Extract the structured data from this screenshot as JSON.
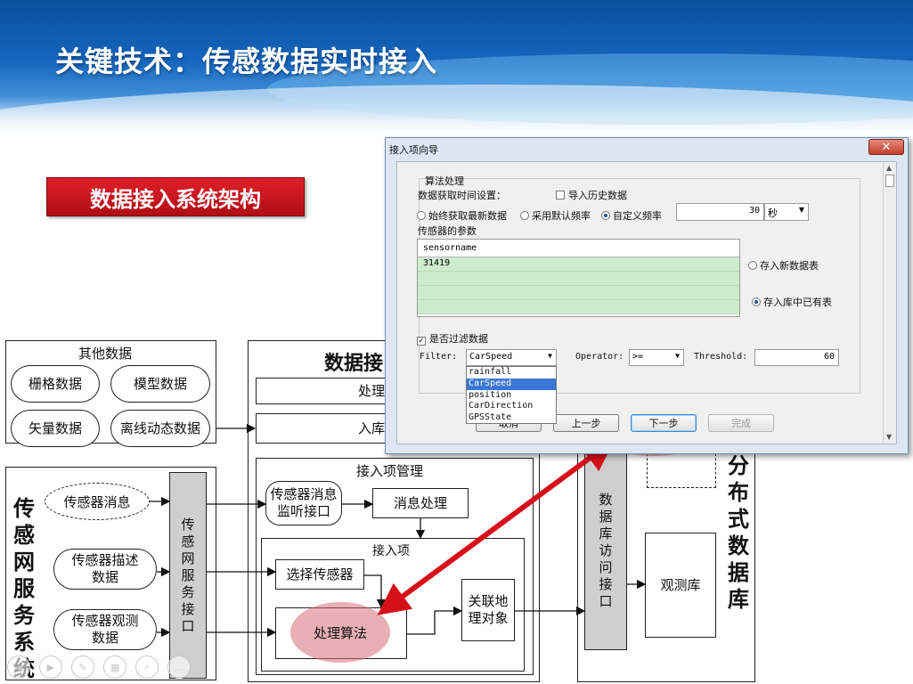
{
  "slide": {
    "title": "关键技术：传感数据实时接入",
    "section_button": "数据接入系统架构"
  },
  "diagram": {
    "other_data": {
      "title": "其他数据",
      "items": [
        "栅格数据",
        "模型数据",
        "矢量数据",
        "离线动态数据"
      ]
    },
    "sensor_service": {
      "title_vertical": [
        "传",
        "感",
        "网",
        "服",
        "务",
        "系",
        "统"
      ],
      "cloud": "传感器消息",
      "describe": "传感器描述\n数据",
      "observe": "传感器观测\n数据",
      "interface_vertical": [
        "传",
        "感",
        "网",
        "服",
        "务",
        "接",
        "口"
      ]
    },
    "access": {
      "title": "数据接",
      "process_bar": "处理",
      "storage_bar": "入库",
      "mgmt_title": "接入项管理",
      "listen": "传感器消息\n监听接口",
      "msg_process": "消息处理",
      "item_title": "接入项",
      "select_sensor": "选择传感器",
      "algorithm": "处理算法",
      "link_geo": "关联地\n理对象"
    },
    "db_interface_vertical": [
      "数",
      "据",
      "库",
      "访",
      "问",
      "接",
      "口"
    ],
    "distributed_db_vertical": [
      "分",
      "布",
      "式",
      "数",
      "据",
      "库"
    ],
    "observe_db": "观测库"
  },
  "dialog": {
    "title": "接入项向导",
    "close": "✕",
    "group_title": "算法处理",
    "time_label": "数据获取时间设置：",
    "import_history": "导入历史数据",
    "radio_latest": "始终获取最新数据",
    "radio_default": "采用默认频率",
    "radio_custom": "自定义频率",
    "freq_value": "30",
    "freq_unit": "秒",
    "params_label": "传感器的参数",
    "table_header": "sensorname",
    "table_rows": [
      "31419",
      "",
      "",
      ""
    ],
    "store_new": "存入新数据表",
    "store_existing": "存入库中已有表",
    "filter_check": "是否过滤数据",
    "filter_label": "Filter:",
    "filter_value": "CarSpeed",
    "filter_options": [
      "rainfall",
      "CarSpeed",
      "position",
      "CarDirection",
      "GPSState"
    ],
    "operator_label": "Operator:",
    "operator_value": ">=",
    "threshold_label": "Threshold:",
    "threshold_value": "60",
    "btn_cancel": "取消",
    "btn_prev": "上一步",
    "btn_next": "下一步",
    "btn_finish": "完成"
  },
  "colors": {
    "accent_red": "#c8101a",
    "arrow_red": "#d6101a",
    "header_blue": "#1565bd"
  },
  "icons": [
    "prev-icon",
    "next-icon",
    "pen-icon",
    "gallery-icon",
    "zoom-icon",
    "more-icon"
  ]
}
